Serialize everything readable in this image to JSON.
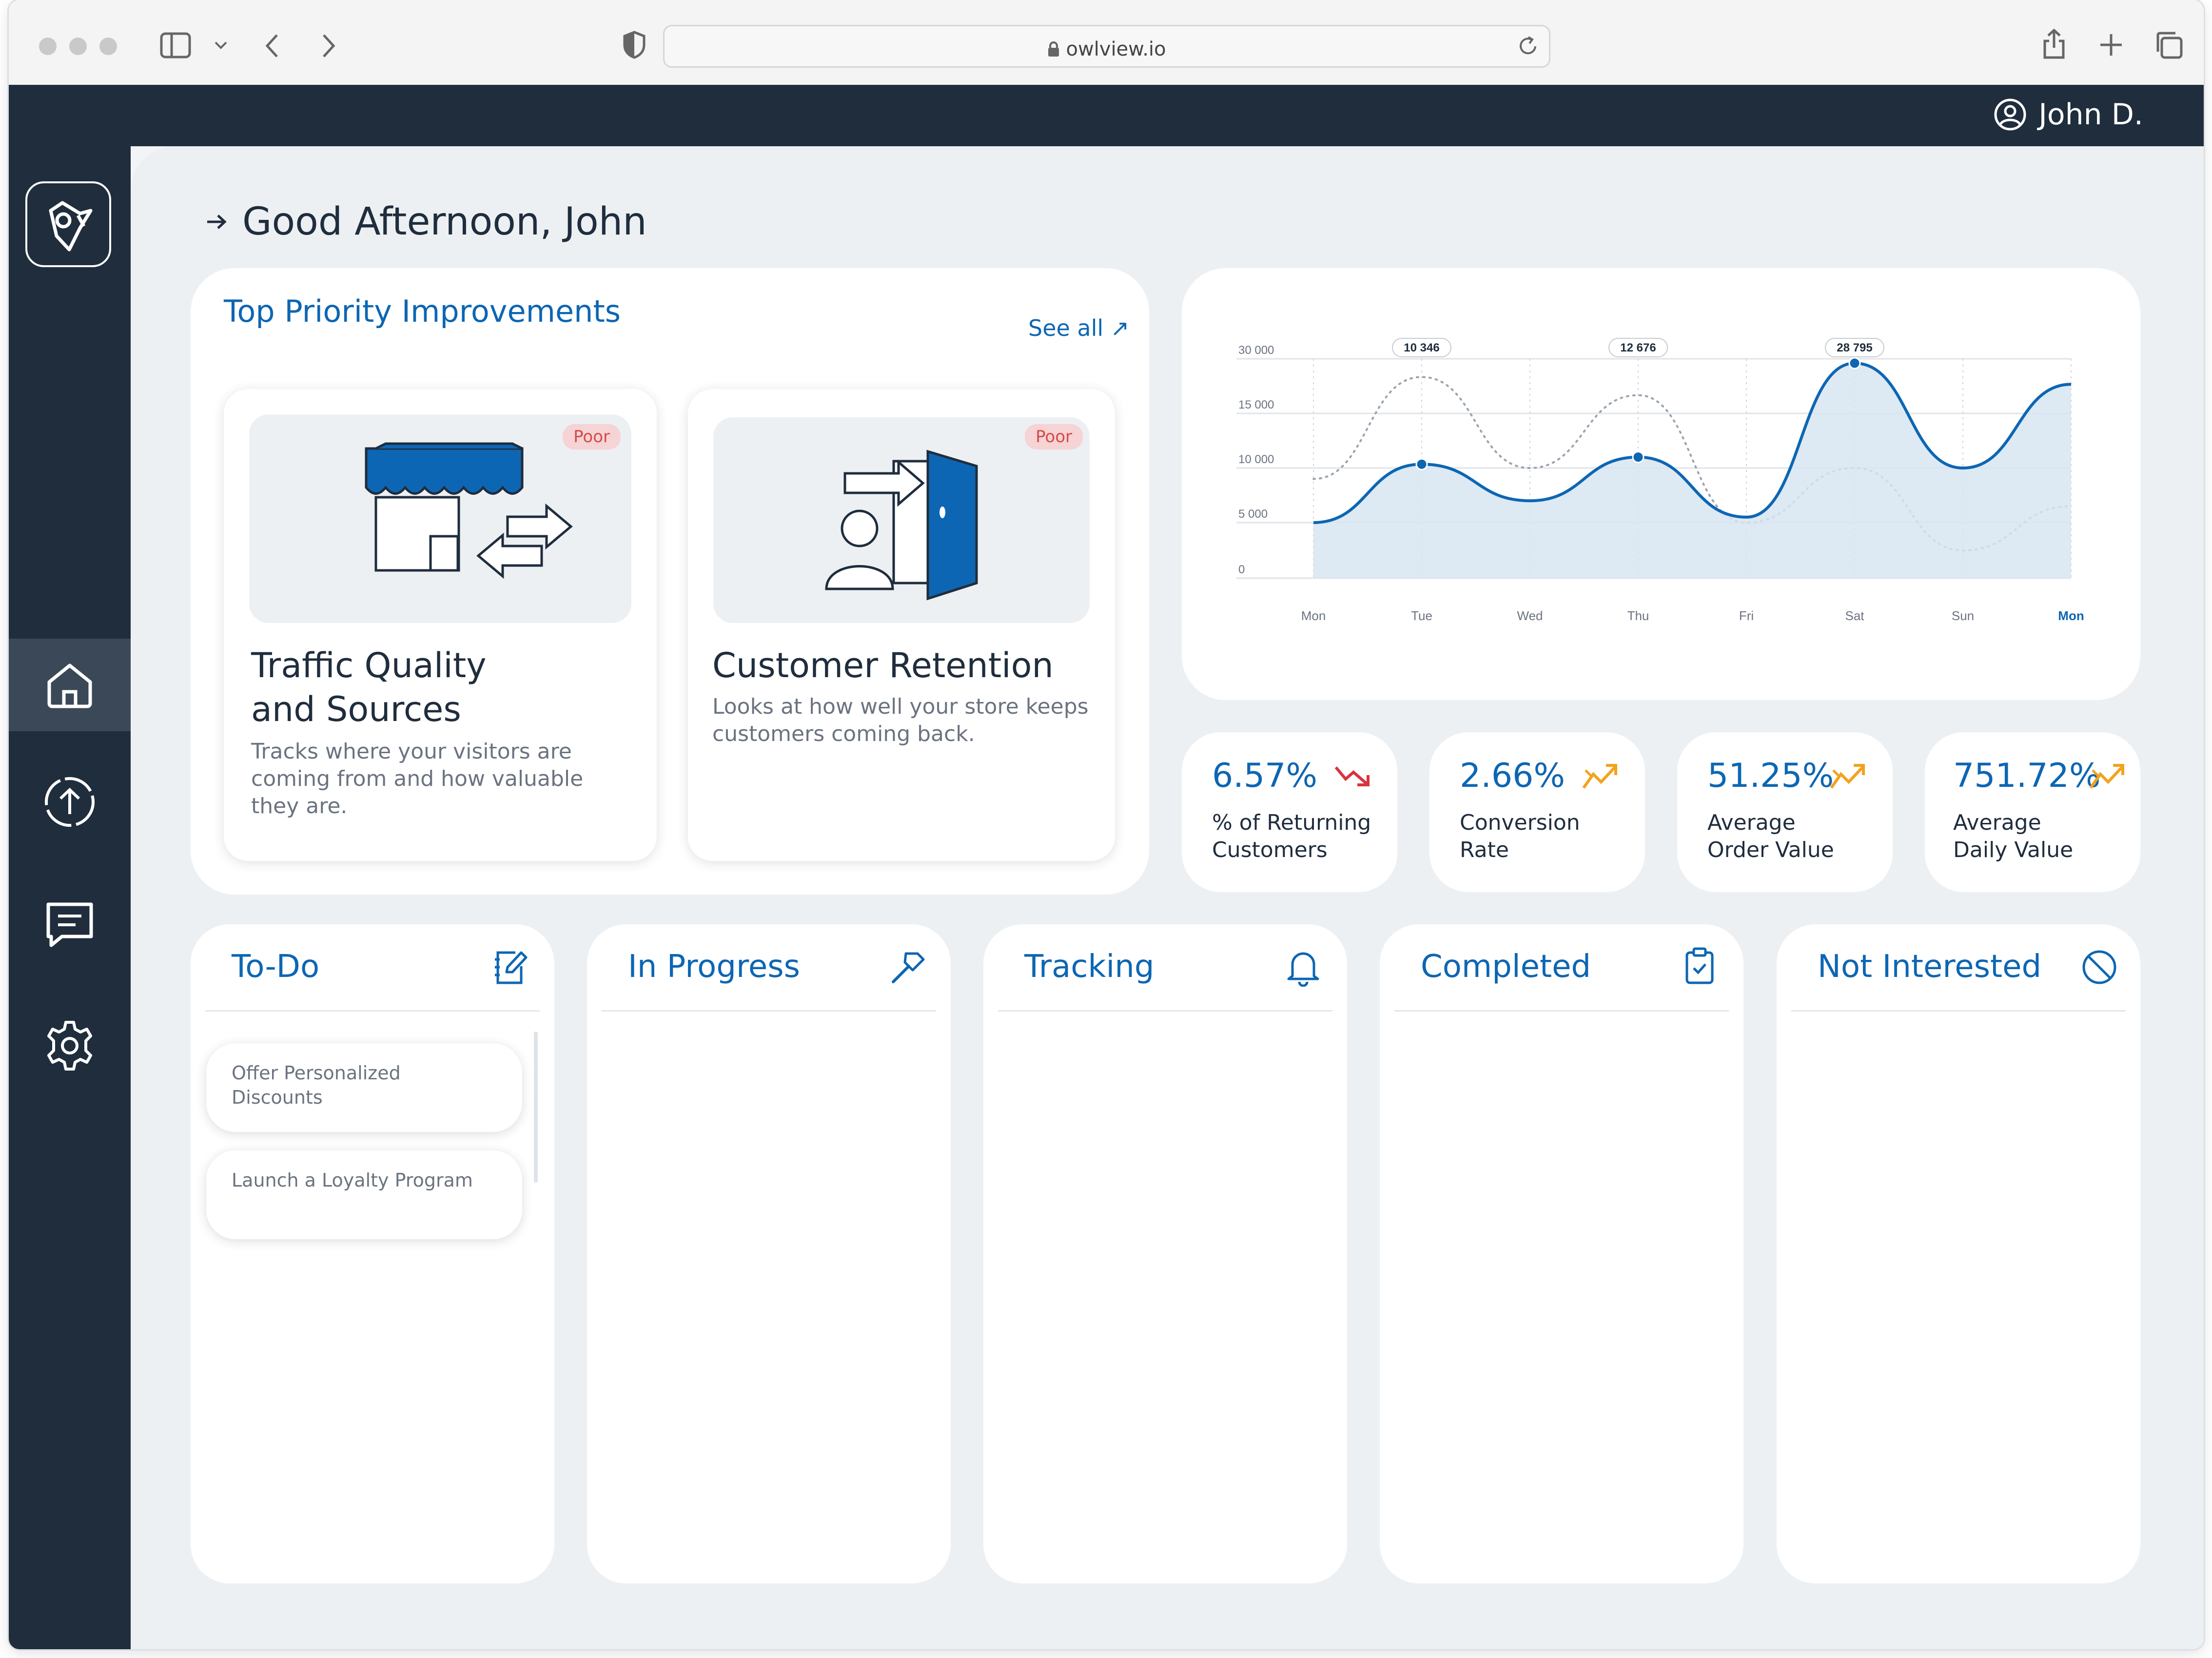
{
  "browser": {
    "url": "owlview.io"
  },
  "user": {
    "name": "John D."
  },
  "greeting": "Good Afternoon, John",
  "priorities": {
    "title": "Top Priority Improvements",
    "see_all": "See all ↗",
    "cards": [
      {
        "title_line1": "Traffic Quality",
        "title_line2": "and Sources",
        "badge": "Poor",
        "desc_lines": [
          "Tracks where your visitors are",
          "coming from and how valuable",
          "they are."
        ]
      },
      {
        "title_line1": "Customer Retention",
        "badge": "Poor",
        "desc_lines": [
          "Looks at how well your store keeps",
          "customers coming back."
        ]
      }
    ]
  },
  "chart_data": {
    "type": "area",
    "x": [
      "Mon",
      "Tue",
      "Wed",
      "Thu",
      "Fri",
      "Sat",
      "Sun",
      "Mon"
    ],
    "yticks": [
      "30 000",
      "15 000",
      "10 000",
      "5 000",
      "0"
    ],
    "series": [
      {
        "values": [
          5000,
          10346,
          7000,
          11000,
          5500,
          28795,
          10000,
          23000
        ]
      },
      {
        "values": [
          9000,
          25000,
          10000,
          20000,
          5000,
          10000,
          2500,
          6500
        ]
      }
    ],
    "annotations": [
      "10 346",
      "12 676",
      "28 795"
    ],
    "highlight_x": "Mon",
    "colors": {
      "line": "#0d66b3",
      "fill": "#d7e5f1",
      "dotted": "#9aa3ad"
    }
  },
  "stats": [
    {
      "value": "6.57%",
      "label1": "% of Returning",
      "label2": "Customers",
      "trend": "down"
    },
    {
      "value": "2.66%",
      "label1": "Conversion",
      "label2": "Rate",
      "trend": "up"
    },
    {
      "value": "51.25%",
      "label1": "Average",
      "label2": "Order Value",
      "trend": "up"
    },
    {
      "value": "751.72%",
      "label1": "Average",
      "label2": "Daily Value",
      "trend": "up"
    }
  ],
  "columns": [
    {
      "title": "To-Do",
      "icon": "edit-icon",
      "tasks": [
        {
          "line1": "Offer Personalized",
          "line2": "Discounts"
        },
        {
          "line1": "Launch a Loyalty Program",
          "line2": ""
        }
      ]
    },
    {
      "title": "In Progress",
      "icon": "hammer-icon"
    },
    {
      "title": "Tracking",
      "icon": "bell-icon"
    },
    {
      "title": "Completed",
      "icon": "clipboard-check-icon"
    },
    {
      "title": "Not Interested",
      "icon": "block-icon"
    }
  ],
  "colors": {
    "accent": "#0d66b3",
    "sidebar": "#1f2d3d",
    "trend_up": "#f2a31c",
    "trend_down": "#d9333f"
  }
}
